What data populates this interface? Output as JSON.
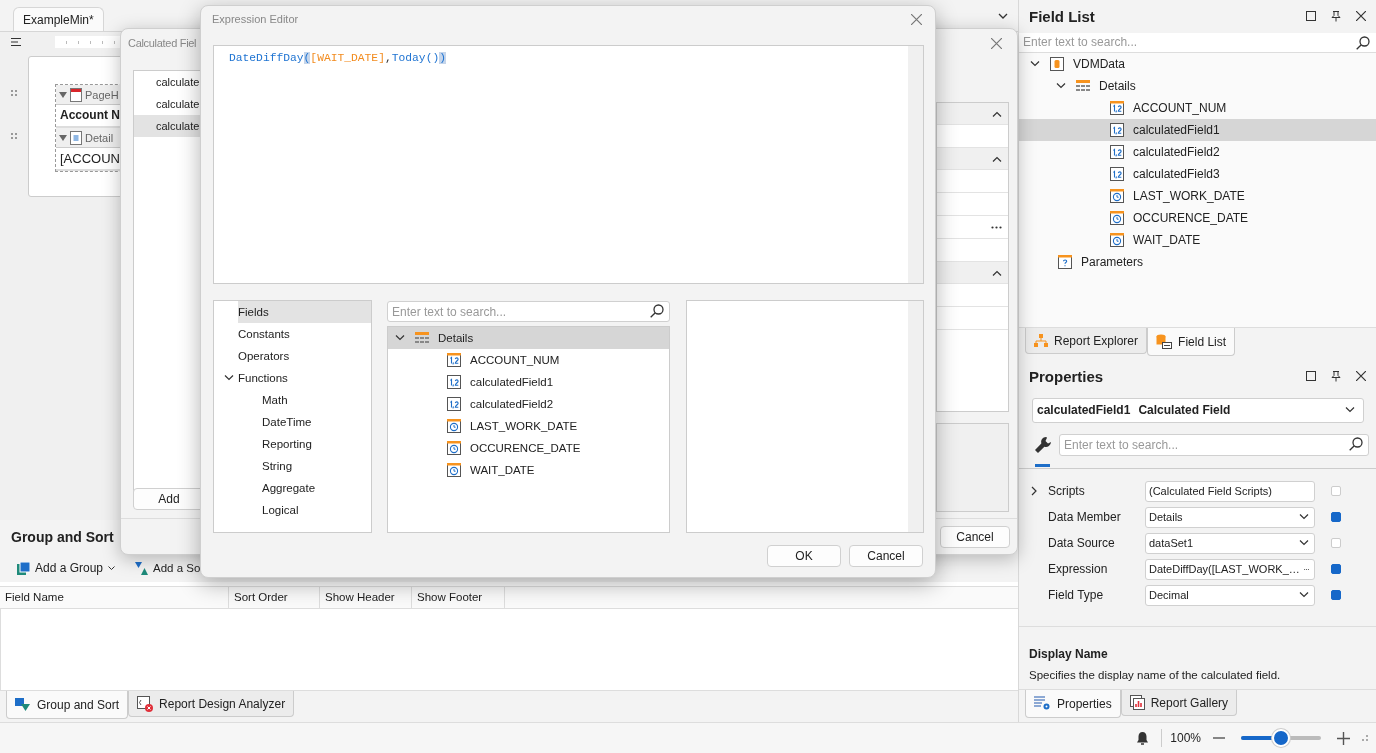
{
  "document_tabs": [
    {
      "label": "ExampleMin*",
      "selected": true
    }
  ],
  "report_bands": [
    {
      "label": "PageH",
      "kind": "page-header",
      "expanded": true,
      "content": "Account N",
      "bold": true
    },
    {
      "label": "Detail",
      "kind": "detail",
      "expanded": true,
      "content": "[ACCOUN",
      "bold": false
    }
  ],
  "group_sort": {
    "title": "Group and Sort",
    "toolbar": [
      {
        "label": "Add a Group",
        "kind": "group",
        "dropdown": true
      },
      {
        "label": "Add a So",
        "kind": "sort",
        "dropdown": false
      }
    ],
    "columns": [
      "Field Name",
      "Sort Order",
      "Show Header",
      "Show Footer"
    ]
  },
  "bottom_tabs": [
    {
      "label": "Group and Sort",
      "kind": "group-sort",
      "selected": true
    },
    {
      "label": "Report Design Analyzer",
      "kind": "analyzer",
      "selected": false
    }
  ],
  "field_list": {
    "title": "Field List",
    "search": {
      "placeholder": "Enter text to search..."
    },
    "tree": [
      {
        "label": "VDMData",
        "kind": "database",
        "expanded": true,
        "selected": false,
        "children": [
          {
            "label": "Details",
            "kind": "table",
            "expanded": true,
            "selected": false,
            "children": [
              {
                "label": "ACCOUNT_NUM",
                "kind": "number",
                "selected": false
              },
              {
                "label": "calculatedField1",
                "kind": "calculated",
                "selected": true
              },
              {
                "label": "calculatedField2",
                "kind": "calculated",
                "selected": false
              },
              {
                "label": "calculatedField3",
                "kind": "calculated",
                "selected": false
              },
              {
                "label": "LAST_WORK_DATE",
                "kind": "date",
                "selected": false
              },
              {
                "label": "OCCURENCE_DATE",
                "kind": "date",
                "selected": false
              },
              {
                "label": "WAIT_DATE",
                "kind": "date",
                "selected": false
              }
            ]
          }
        ]
      },
      {
        "label": "Parameters",
        "kind": "parameters",
        "selected": false
      }
    ]
  },
  "field_list_tabs": [
    {
      "label": "Report Explorer",
      "kind": "explorer",
      "selected": false
    },
    {
      "label": "Field List",
      "kind": "fields",
      "selected": true
    }
  ],
  "properties": {
    "title": "Properties",
    "object": {
      "name": "calculatedField1",
      "type": "Calculated Field"
    },
    "search": {
      "placeholder": "Enter text to search..."
    },
    "rows": [
      {
        "name": "Scripts",
        "value": "(Calculated Field Scripts)",
        "kind": "expandable",
        "modified": false
      },
      {
        "name": "Data Member",
        "value": "Details",
        "kind": "dropdown",
        "modified": true
      },
      {
        "name": "Data Source",
        "value": "dataSet1",
        "kind": "dropdown",
        "modified": false
      },
      {
        "name": "Expression",
        "value": "DateDiffDay([LAST_WORK_…",
        "kind": "ellipsis",
        "modified": true
      },
      {
        "name": "Field Type",
        "value": "Decimal",
        "kind": "dropdown",
        "modified": true
      }
    ],
    "description": {
      "title": "Display Name",
      "text": "Specifies the display name of the calculated field."
    }
  },
  "properties_tabs": [
    {
      "label": "Properties",
      "kind": "properties",
      "selected": true
    },
    {
      "label": "Report Gallery",
      "kind": "gallery",
      "selected": false
    }
  ],
  "status_bar": {
    "zoom": "100%",
    "zoom_slider": {
      "level": 0.49
    }
  },
  "calculated_fields_dialog": {
    "title": "Calculated Fiel",
    "items": [
      {
        "label": "calculate",
        "selected": false
      },
      {
        "label": "calculate",
        "selected": false
      },
      {
        "label": "calculate",
        "selected": true
      }
    ],
    "add_button": "Add",
    "cancel_button": "Cancel",
    "grid_rows": [
      {
        "kind": "category",
        "expanded": true
      },
      {
        "kind": "property"
      },
      {
        "kind": "category",
        "expanded": true
      },
      {
        "kind": "property"
      },
      {
        "kind": "property"
      },
      {
        "kind": "button"
      },
      {
        "kind": "property"
      },
      {
        "kind": "category",
        "expanded": true
      },
      {
        "kind": "property"
      },
      {
        "kind": "property"
      }
    ]
  },
  "expression_editor": {
    "title": "Expression Editor",
    "expression": [
      {
        "text": "DateDiffDay",
        "kind": "function",
        "matched": false
      },
      {
        "text": "(",
        "kind": "paren",
        "matched": true
      },
      {
        "text": "[WAIT_DATE]",
        "kind": "field",
        "matched": false
      },
      {
        "text": ",",
        "kind": "separator",
        "matched": false
      },
      {
        "text": "Today",
        "kind": "function",
        "matched": false
      },
      {
        "text": "()",
        "kind": "paren",
        "matched": false
      },
      {
        "text": ")",
        "kind": "paren",
        "matched": true
      }
    ],
    "categories": [
      {
        "label": "Fields",
        "selected": true
      },
      {
        "label": "Constants",
        "selected": false
      },
      {
        "label": "Operators",
        "selected": false
      },
      {
        "label": "Functions",
        "selected": false,
        "expanded": true,
        "children": [
          {
            "label": "Math",
            "selected": false
          },
          {
            "label": "DateTime",
            "selected": false
          },
          {
            "label": "Reporting",
            "selected": false
          },
          {
            "label": "String",
            "selected": false
          },
          {
            "label": "Aggregate",
            "selected": false
          },
          {
            "label": "Logical",
            "selected": false
          }
        ]
      }
    ],
    "search": {
      "placeholder": "Enter text to search..."
    },
    "fields_tree": [
      {
        "label": "Details",
        "kind": "table",
        "expanded": true,
        "selected": true,
        "children": [
          {
            "label": "ACCOUNT_NUM",
            "kind": "number",
            "selected": false
          },
          {
            "label": "calculatedField1",
            "kind": "calculated",
            "selected": false
          },
          {
            "label": "calculatedField2",
            "kind": "calculated",
            "selected": false
          },
          {
            "label": "LAST_WORK_DATE",
            "kind": "date",
            "selected": false
          },
          {
            "label": "OCCURENCE_DATE",
            "kind": "date",
            "selected": false
          },
          {
            "label": "WAIT_DATE",
            "kind": "date",
            "selected": false
          }
        ]
      }
    ],
    "buttons": [
      "OK",
      "Cancel"
    ]
  }
}
